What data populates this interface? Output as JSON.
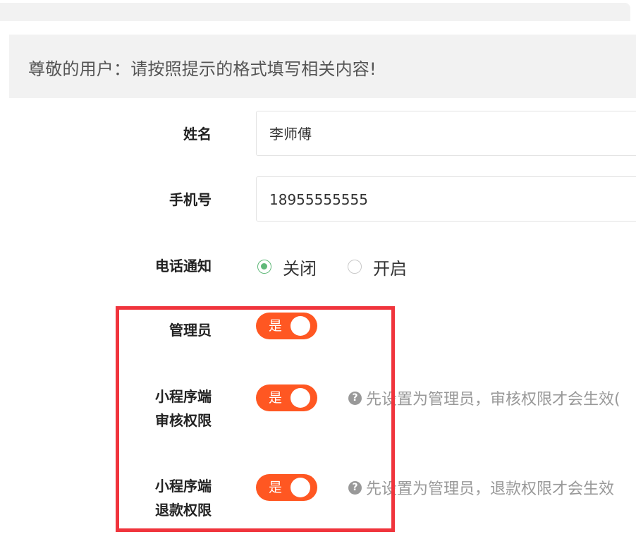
{
  "notice": {
    "text": "尊敬的用户：请按照提示的格式填写相关内容!"
  },
  "form": {
    "name": {
      "label": "姓名",
      "value": "李师傅"
    },
    "phone": {
      "label": "手机号",
      "value": "18955555555"
    },
    "call_notify": {
      "label": "电话通知",
      "options": [
        {
          "label": "关闭",
          "checked": true
        },
        {
          "label": "开启",
          "checked": false
        }
      ]
    },
    "admin": {
      "label": "管理员",
      "switch_text": "是",
      "on": true
    },
    "mp_audit": {
      "label_line1": "小程序端",
      "label_line2": "审核权限",
      "switch_text": "是",
      "on": true,
      "tip": "先设置为管理员，审核权限才会生效("
    },
    "mp_refund": {
      "label_line1": "小程序端",
      "label_line2": "退款权限",
      "switch_text": "是",
      "on": true,
      "tip": "先设置为管理员，退款权限才会生效"
    }
  },
  "colors": {
    "switch_on": "#ff5722",
    "radio_checked": "#5fb878",
    "highlight_box": "#f0343c"
  }
}
